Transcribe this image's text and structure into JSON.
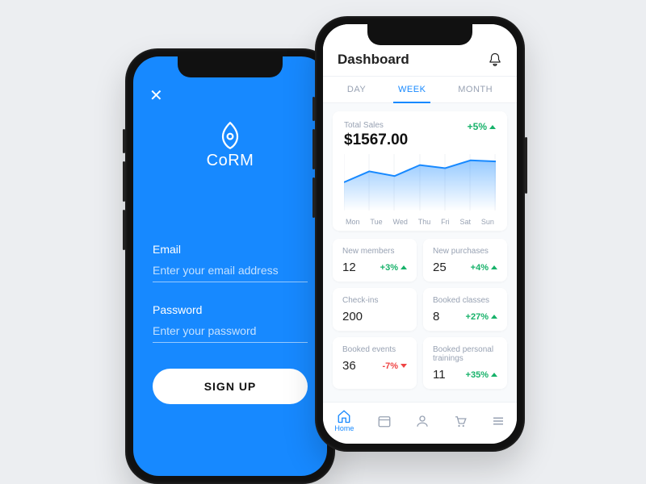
{
  "colors": {
    "brand": "#1789ff",
    "positive": "#17b26a",
    "negative": "#ef4444"
  },
  "login": {
    "brand": "CoRM",
    "email_label": "Email",
    "email_placeholder": "Enter your email address",
    "password_label": "Password",
    "password_placeholder": "Enter your password",
    "submit_label": "SIGN UP"
  },
  "dashboard": {
    "title": "Dashboard",
    "tabs": {
      "day": "DAY",
      "week": "WEEK",
      "month": "MONTH",
      "active": "week"
    },
    "chart": {
      "label": "Total Sales",
      "value": "$1567.00",
      "delta": "+5%",
      "delta_dir": "up",
      "days": [
        "Mon",
        "Tue",
        "Wed",
        "Thu",
        "Fri",
        "Sat",
        "Sun"
      ]
    },
    "stats": [
      {
        "title": "New members",
        "value": "12",
        "delta": "+3%",
        "dir": "up"
      },
      {
        "title": "New purchases",
        "value": "25",
        "delta": "+4%",
        "dir": "up"
      },
      {
        "title": "Check-ins",
        "value": "200",
        "delta": "",
        "dir": ""
      },
      {
        "title": "Booked classes",
        "value": "8",
        "delta": "+27%",
        "dir": "up"
      },
      {
        "title": "Booked events",
        "value": "36",
        "delta": "-7%",
        "dir": "down"
      },
      {
        "title": "Booked personal trainings",
        "value": "11",
        "delta": "+35%",
        "dir": "up"
      }
    ],
    "tabbar": {
      "home": "Home"
    }
  },
  "chart_data": {
    "type": "area",
    "title": "Total Sales",
    "categories": [
      "Mon",
      "Tue",
      "Wed",
      "Thu",
      "Fri",
      "Sat",
      "Sun"
    ],
    "values": [
      900,
      1250,
      1100,
      1450,
      1350,
      1600,
      1567
    ],
    "ylim": [
      0,
      1800
    ],
    "ylabel": "",
    "xlabel": "",
    "delta_pct": 5
  }
}
